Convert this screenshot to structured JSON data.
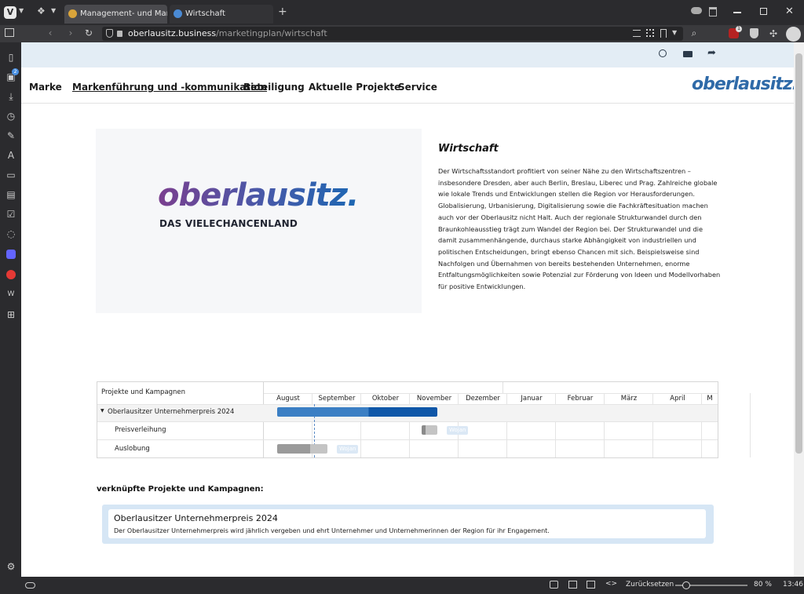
{
  "browser": {
    "tabs": [
      {
        "label": "Management- und Marketin",
        "active": true
      },
      {
        "label": "Wirtschaft",
        "active": false
      }
    ],
    "url": {
      "host": "oberlausitz.business",
      "path": "/marketingplan/wirtschaft"
    },
    "sidebar_badge": "2",
    "ext_badge": "1",
    "status": {
      "reset_label": "Zurücksetzen",
      "zoom": "80 %",
      "zoom_fraction": 0.15,
      "time": "13:46"
    }
  },
  "site": {
    "nav": [
      "Marke",
      "Markenführung und -kommunikation",
      "Beteiligung",
      "Aktuelle Projekte",
      "Service"
    ],
    "brand": "oberlausitz.",
    "hero_logo": {
      "word": "oberlausitz.",
      "tagline": "DAS VIELECHANCENLAND"
    },
    "colors": {
      "accent": "#2f6aa8",
      "brand_purple": "#7a3f8f",
      "brand_blue": "#1c67b3"
    }
  },
  "article": {
    "title": "Wirtschaft",
    "body": "Der Wirtschaftsstandort profitiert von seiner Nähe zu den Wirtschaftszentren – insbesondere Dresden, aber auch Berlin, Breslau, Liberec und Prag. Zahlreiche globale wie lokale Trends und Entwicklungen stellen die Region vor Herausforderungen. Globalisierung, Urbanisierung, Digitalisierung sowie die Fachkräftesituation machen auch vor der Oberlausitz nicht Halt. Auch der regionale Strukturwandel durch den Braunkohleausstieg trägt zum Wandel der Region bei. Der Strukturwandel und die damit zusammenhängende, durchaus starke Abhängigkeit von industriellen und politischen Entscheidungen, bringt ebenso Chancen mit sich. Beispielsweise sind Nachfolgen und Übernahmen von bereits bestehenden Unternehmen, enorme Entfaltungsmöglichkeiten sowie Potenzial zur Förderung von Ideen und Modellvorhaben für positive Entwicklungen."
  },
  "gantt": {
    "column_header": "Projekte und Kampagnen",
    "months": [
      "August",
      "September",
      "Oktober",
      "November",
      "Dezember",
      "Januar",
      "Februar",
      "März",
      "April",
      "M"
    ],
    "rows": [
      {
        "label": "Oberlausitzer Unternehmerpreis 2024",
        "group": true
      },
      {
        "label": "Preisverleihung",
        "chip": "Wojan"
      },
      {
        "label": "Auslobung",
        "chip": "Wojan"
      }
    ]
  },
  "linked": {
    "heading": "verknüpfte Projekte und Kampagnen:",
    "items": [
      {
        "title": "Oberlausitzer Unternehmerpreis 2024",
        "desc": "Der Oberlausitzer Unternehmerpreis wird jährlich vergeben und ehrt Unternehmer und Unternehmerinnen der Region für ihr Engagement."
      }
    ]
  }
}
